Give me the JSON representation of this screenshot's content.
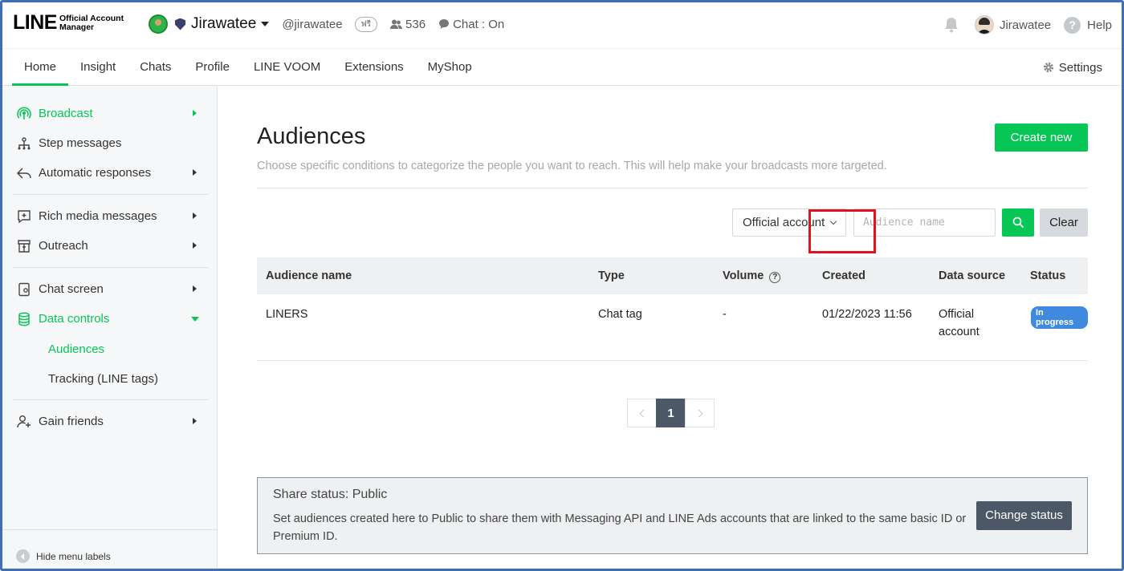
{
  "brand": {
    "logo_main": "LINE",
    "logo_sub_line1": "Official Account",
    "logo_sub_line2": "Manager",
    "accent": "#06c755"
  },
  "account": {
    "name": "Jirawatee",
    "id": "@jirawatee",
    "badge": "ฟรี",
    "friends": "536",
    "chat_status": "Chat : On"
  },
  "user": {
    "name": "Jirawatee",
    "help": "Help"
  },
  "nav": {
    "tabs": [
      {
        "label": "Home"
      },
      {
        "label": "Insight"
      },
      {
        "label": "Chats"
      },
      {
        "label": "Profile"
      },
      {
        "label": "LINE VOOM"
      },
      {
        "label": "Extensions"
      },
      {
        "label": "MyShop"
      }
    ],
    "settings": "Settings"
  },
  "sidebar": {
    "broadcast": "Broadcast",
    "step_messages": "Step messages",
    "auto_responses": "Automatic responses",
    "rich_media": "Rich media messages",
    "outreach": "Outreach",
    "chat_screen": "Chat screen",
    "data_controls": "Data controls",
    "audiences": "Audiences",
    "tracking": "Tracking (LINE tags)",
    "gain_friends": "Gain friends",
    "hide_labels": "Hide menu labels"
  },
  "page": {
    "title": "Audiences",
    "description": "Choose specific conditions to categorize the people you want to reach. This will help make your broadcasts more targeted.",
    "create_button": "Create new"
  },
  "filters": {
    "source_select": "Official account",
    "search_placeholder": "Audience name",
    "clear": "Clear"
  },
  "table": {
    "headers": {
      "name": "Audience name",
      "type": "Type",
      "volume": "Volume",
      "created": "Created",
      "source": "Data source",
      "status": "Status"
    },
    "rows": [
      {
        "name": "LINERS",
        "type": "Chat tag",
        "volume": "-",
        "created": "01/22/2023 11:56",
        "source_line1": "Official",
        "source_line2": "account",
        "status": "In progress"
      }
    ]
  },
  "pagination": {
    "current": "1"
  },
  "share": {
    "title": "Share status: Public",
    "description": "Set audiences created here to Public to share them with Messaging API and LINE Ads accounts that are linked to the same basic ID or Premium ID.",
    "button": "Change status"
  }
}
